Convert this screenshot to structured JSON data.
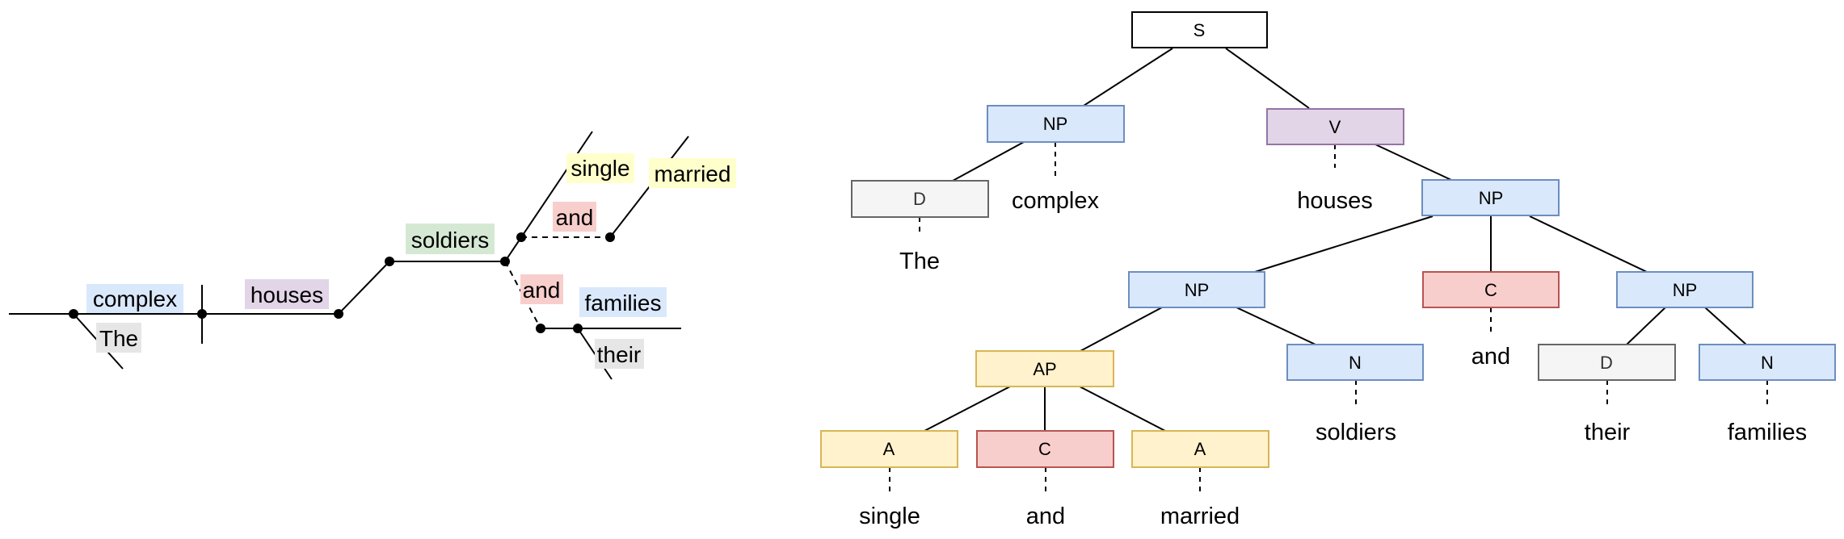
{
  "reed_kellogg": {
    "words": {
      "the": "The",
      "complex": "complex",
      "houses": "houses",
      "soldiers": "soldiers",
      "single": "single",
      "and_ap": "and",
      "married": "married",
      "and_np": "and",
      "families": "families",
      "their": "their"
    },
    "label_colors": {
      "the": "#e6e6e6",
      "complex": "#dae8fc",
      "houses": "#e1d5e7",
      "soldiers": "#d5e8d4",
      "single": "#ffffcc",
      "and_ap": "#f8cecc",
      "married": "#ffffcc",
      "and_np": "#f8cecc",
      "families": "#dae8fc",
      "their": "#e6e6e6"
    }
  },
  "tree": {
    "nodes": {
      "s": "S",
      "np_subj": "NP",
      "v": "V",
      "d_the": "D",
      "np_obj": "NP",
      "np_coord1": "NP",
      "c_np": "C",
      "np_coord2": "NP",
      "ap": "AP",
      "n_soldiers": "N",
      "d_their": "D",
      "n_families": "N",
      "a_single": "A",
      "c_ap": "C",
      "a_married": "A"
    },
    "leaves": {
      "the": "The",
      "complex": "complex",
      "houses": "houses",
      "and_np": "and",
      "soldiers": "soldiers",
      "their": "their",
      "families": "families",
      "single": "single",
      "and_ap": "and",
      "married": "married"
    },
    "category_styles": {
      "S": {
        "fill": "#ffffff",
        "stroke": "#000000",
        "text": "#000000"
      },
      "NP": {
        "fill": "#dae8fc",
        "stroke": "#6c8ebf",
        "text": "#000000"
      },
      "N": {
        "fill": "#dae8fc",
        "stroke": "#6c8ebf",
        "text": "#000000"
      },
      "V": {
        "fill": "#e1d5e7",
        "stroke": "#9673a6",
        "text": "#000000"
      },
      "D": {
        "fill": "#f5f5f5",
        "stroke": "#666666",
        "text": "#333333"
      },
      "C": {
        "fill": "#f8cecc",
        "stroke": "#b85450",
        "text": "#000000"
      },
      "AP": {
        "fill": "#fff2cc",
        "stroke": "#d6b656",
        "text": "#000000"
      },
      "A": {
        "fill": "#fff2cc",
        "stroke": "#d6b656",
        "text": "#000000"
      }
    }
  }
}
